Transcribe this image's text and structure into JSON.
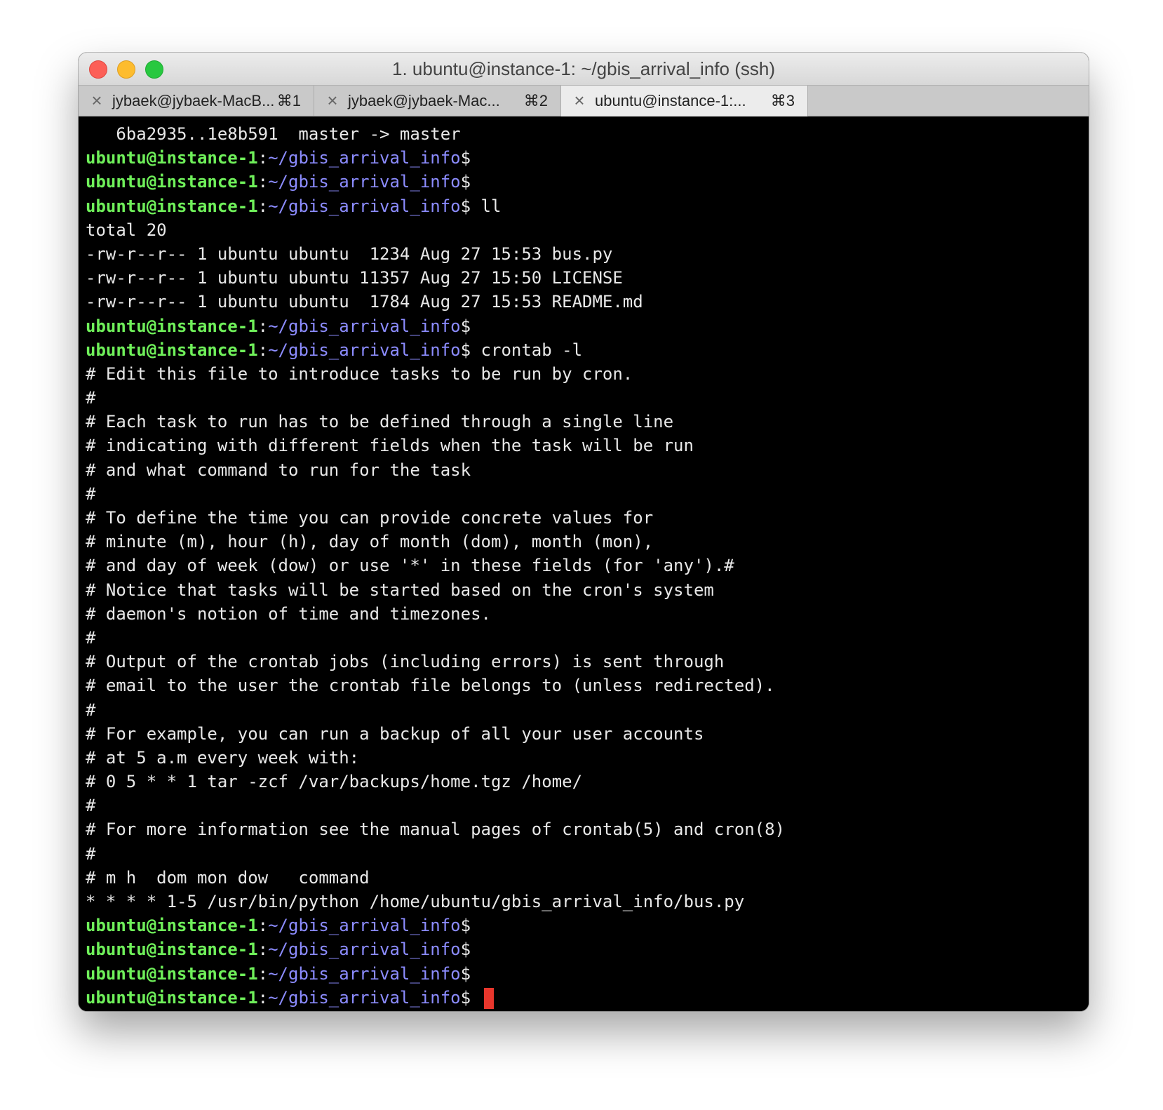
{
  "window": {
    "title": "1. ubuntu@instance-1: ~/gbis_arrival_info (ssh)"
  },
  "tabs": [
    {
      "close": "×",
      "label": "jybaek@jybaek-MacB...",
      "shortcut": "⌘1",
      "active": false
    },
    {
      "close": "×",
      "label": "jybaek@jybaek-Mac...",
      "shortcut": "⌘2",
      "active": false
    },
    {
      "close": "×",
      "label": "ubuntu@instance-1:...",
      "shortcut": "⌘3",
      "active": true
    }
  ],
  "prompt": {
    "user": "ubuntu@instance-1",
    "colon": ":",
    "path": "~/gbis_arrival_info",
    "dollar": "$"
  },
  "colors": {
    "prompt_user": "#6ff05a",
    "prompt_path": "#8c8cff",
    "cursor": "#e8362c",
    "background": "#000000"
  },
  "terminal_lines": [
    {
      "type": "out",
      "text": "   6ba2935..1e8b591  master -> master"
    },
    {
      "type": "prompt",
      "cmd": ""
    },
    {
      "type": "prompt",
      "cmd": ""
    },
    {
      "type": "prompt",
      "cmd": " ll"
    },
    {
      "type": "out",
      "text": "total 20"
    },
    {
      "type": "out",
      "text": "-rw-r--r-- 1 ubuntu ubuntu  1234 Aug 27 15:53 bus.py"
    },
    {
      "type": "out",
      "text": "-rw-r--r-- 1 ubuntu ubuntu 11357 Aug 27 15:50 LICENSE"
    },
    {
      "type": "out",
      "text": "-rw-r--r-- 1 ubuntu ubuntu  1784 Aug 27 15:53 README.md"
    },
    {
      "type": "prompt",
      "cmd": ""
    },
    {
      "type": "prompt",
      "cmd": " crontab -l"
    },
    {
      "type": "out",
      "text": "# Edit this file to introduce tasks to be run by cron."
    },
    {
      "type": "out",
      "text": "#"
    },
    {
      "type": "out",
      "text": "# Each task to run has to be defined through a single line"
    },
    {
      "type": "out",
      "text": "# indicating with different fields when the task will be run"
    },
    {
      "type": "out",
      "text": "# and what command to run for the task"
    },
    {
      "type": "out",
      "text": "#"
    },
    {
      "type": "out",
      "text": "# To define the time you can provide concrete values for"
    },
    {
      "type": "out",
      "text": "# minute (m), hour (h), day of month (dom), month (mon),"
    },
    {
      "type": "out",
      "text": "# and day of week (dow) or use '*' in these fields (for 'any').#"
    },
    {
      "type": "out",
      "text": "# Notice that tasks will be started based on the cron's system"
    },
    {
      "type": "out",
      "text": "# daemon's notion of time and timezones."
    },
    {
      "type": "out",
      "text": "#"
    },
    {
      "type": "out",
      "text": "# Output of the crontab jobs (including errors) is sent through"
    },
    {
      "type": "out",
      "text": "# email to the user the crontab file belongs to (unless redirected)."
    },
    {
      "type": "out",
      "text": "#"
    },
    {
      "type": "out",
      "text": "# For example, you can run a backup of all your user accounts"
    },
    {
      "type": "out",
      "text": "# at 5 a.m every week with:"
    },
    {
      "type": "out",
      "text": "# 0 5 * * 1 tar -zcf /var/backups/home.tgz /home/"
    },
    {
      "type": "out",
      "text": "#"
    },
    {
      "type": "out",
      "text": "# For more information see the manual pages of crontab(5) and cron(8)"
    },
    {
      "type": "out",
      "text": "#"
    },
    {
      "type": "out",
      "text": "# m h  dom mon dow   command"
    },
    {
      "type": "out",
      "text": "* * * * 1-5 /usr/bin/python /home/ubuntu/gbis_arrival_info/bus.py"
    },
    {
      "type": "prompt",
      "cmd": ""
    },
    {
      "type": "prompt",
      "cmd": ""
    },
    {
      "type": "prompt",
      "cmd": ""
    },
    {
      "type": "prompt",
      "cmd": " ",
      "cursor": true
    }
  ]
}
